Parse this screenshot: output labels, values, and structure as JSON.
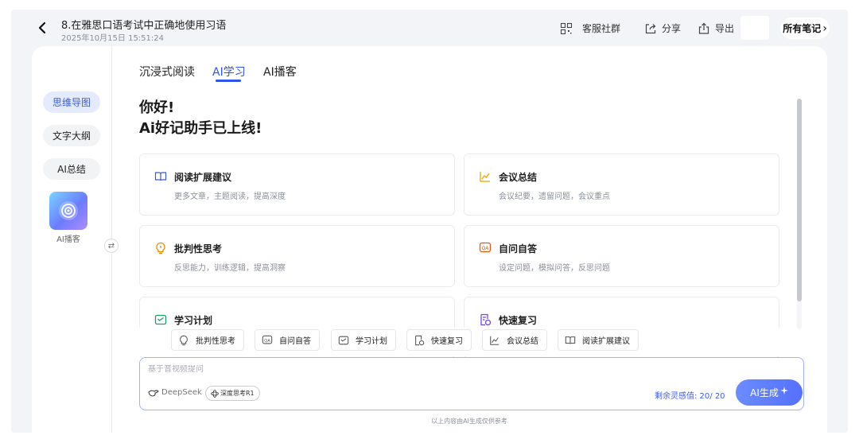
{
  "header": {
    "title": "8.在雅思口语考试中正确地使用习语",
    "datetime": "2025年10月15日 15:51:24",
    "customer_group": "客服社群",
    "share": "分享",
    "export": "导出",
    "all_notes": "所有笔记",
    "all_notes_chevron": "›"
  },
  "sidebar": {
    "items": [
      {
        "label": "思维导图",
        "active": true
      },
      {
        "label": "文字大纲",
        "active": false
      },
      {
        "label": "AI总结",
        "active": false
      }
    ],
    "podcast_label": "AI播客",
    "swap_glyph": "⇄"
  },
  "tabs": [
    {
      "label": "沉浸式阅读",
      "active": false
    },
    {
      "label": "AI学习",
      "active": true
    },
    {
      "label": "AI播客",
      "active": false
    }
  ],
  "greeting": {
    "line1": "你好!",
    "line2": "Ai好记助手已上线!"
  },
  "cards": [
    {
      "title": "阅读扩展建议",
      "desc": "更多文章，主题阅读，提高深度",
      "icon": "book-icon",
      "color": "#3b5bdb"
    },
    {
      "title": "会议总结",
      "desc": "会议纪要，遗留问题，会议重点",
      "icon": "chart-icon",
      "color": "#f2a100"
    },
    {
      "title": "批判性思考",
      "desc": "反思能力，训练逻辑，提高洞察",
      "icon": "bulb-icon",
      "color": "#f08c00"
    },
    {
      "title": "自问自答",
      "desc": "设定问题，模拟问答，反思问题",
      "icon": "qa-icon",
      "color": "#e8590c"
    },
    {
      "title": "学习计划",
      "desc": "",
      "icon": "plan-icon",
      "color": "#1c9d6a"
    },
    {
      "title": "快速复习",
      "desc": "",
      "icon": "review-icon",
      "color": "#7048e8"
    }
  ],
  "chips": [
    {
      "label": "批判性思考",
      "icon": "bulb-icon"
    },
    {
      "label": "自问自答",
      "icon": "qa-icon"
    },
    {
      "label": "学习计划",
      "icon": "plan-icon"
    },
    {
      "label": "快速复习",
      "icon": "review-icon"
    },
    {
      "label": "会议总结",
      "icon": "chart-icon"
    },
    {
      "label": "阅读扩展建议",
      "icon": "book-icon"
    }
  ],
  "input": {
    "placeholder": "基于音视频提问",
    "value": "",
    "model_label": "DeepSeek",
    "deep_think": "深度思考R1",
    "quota": "剩余灵感值: 20/ 20",
    "generate": "AI生成"
  },
  "disclaimer": "以上内容由AI生成仅供参考"
}
